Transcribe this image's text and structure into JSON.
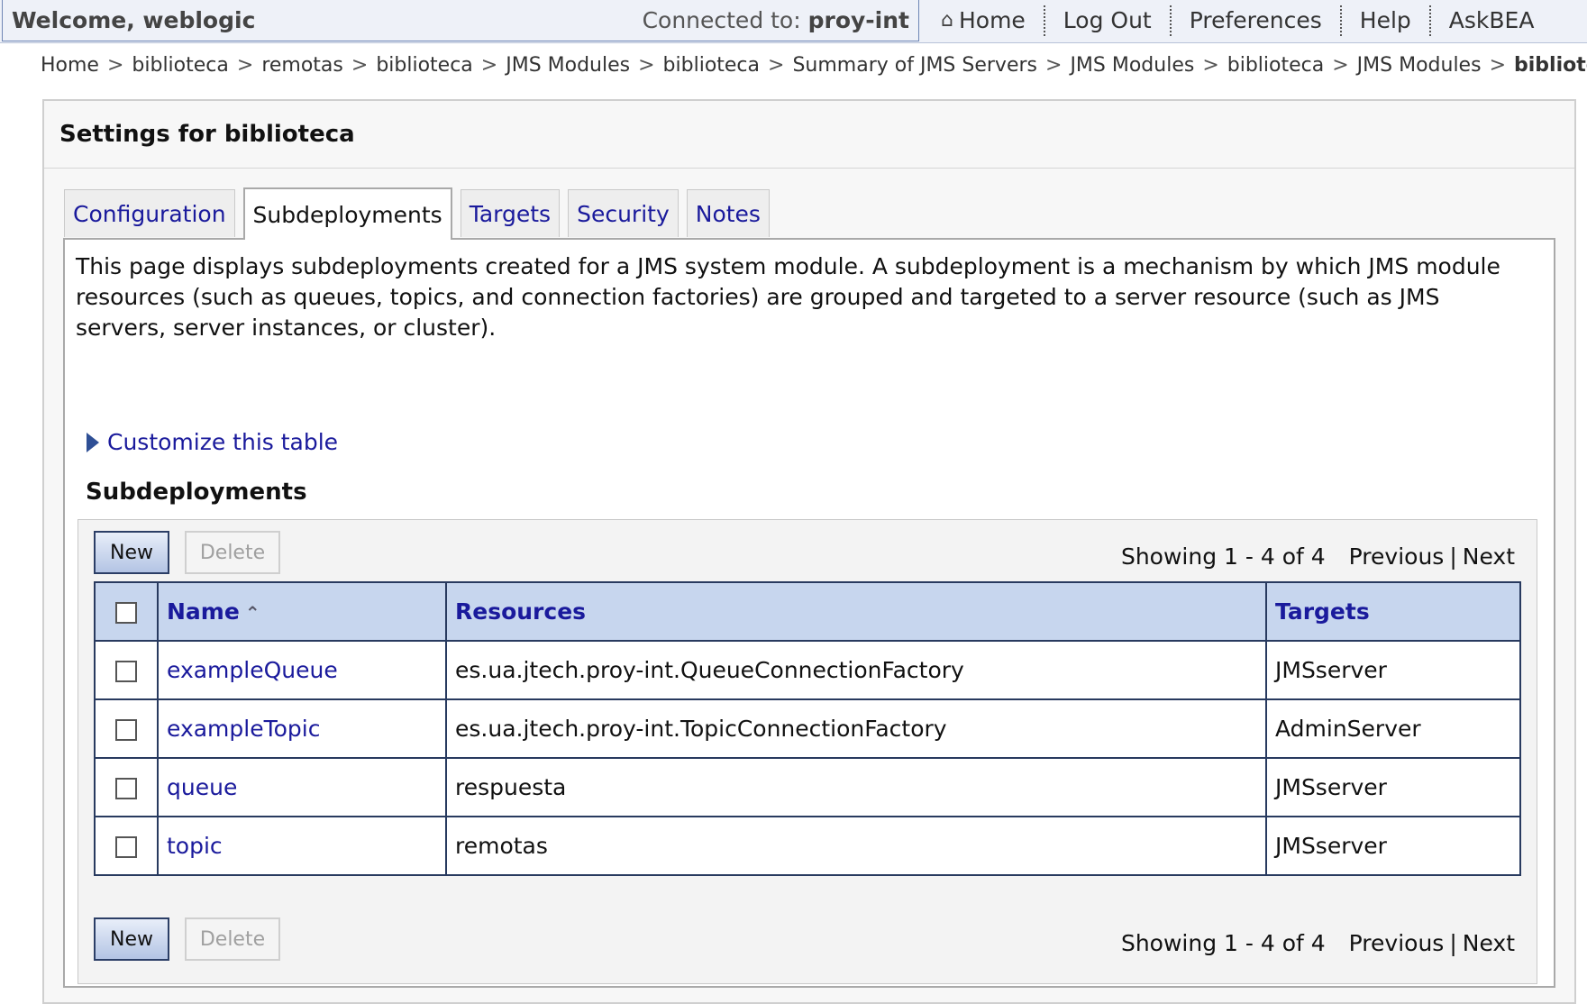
{
  "topbar": {
    "welcome": "Welcome, weblogic",
    "connected_label": "Connected to:",
    "connected_server": "proy-int",
    "nav": [
      {
        "label": "Home",
        "icon": "home-icon"
      },
      {
        "label": "Log Out"
      },
      {
        "label": "Preferences"
      },
      {
        "label": "Help"
      },
      {
        "label": "AskBEA"
      }
    ]
  },
  "breadcrumb": {
    "items": [
      "Home",
      "biblioteca",
      "remotas",
      "biblioteca",
      "JMS Modules",
      "biblioteca",
      "Summary of JMS Servers",
      "JMS Modules",
      "biblioteca",
      "JMS Modules"
    ],
    "separator": ">",
    "current": "biblioteca"
  },
  "settings": {
    "title": "Settings for biblioteca",
    "tabs": [
      {
        "label": "Configuration",
        "active": false
      },
      {
        "label": "Subdeployments",
        "active": true
      },
      {
        "label": "Targets",
        "active": false
      },
      {
        "label": "Security",
        "active": false
      },
      {
        "label": "Notes",
        "active": false
      }
    ],
    "description": "This page displays subdeployments created for a JMS system module. A subdeployment is a mechanism by which JMS module resources (such as queues, topics, and connection factories) are grouped and targeted to a server resource (such as JMS servers, server instances, or cluster).",
    "customize_label": "Customize this table",
    "table_title": "Subdeployments"
  },
  "table": {
    "new_label": "New",
    "delete_label": "Delete",
    "showing": "Showing 1 - 4 of 4",
    "previous": "Previous",
    "pipe": "|",
    "next": "Next",
    "columns": [
      "Name",
      "Resources",
      "Targets"
    ],
    "rows": [
      {
        "name": "exampleQueue",
        "resources": "es.ua.jtech.proy-int.QueueConnectionFactory",
        "targets": "JMSserver"
      },
      {
        "name": "exampleTopic",
        "resources": "es.ua.jtech.proy-int.TopicConnectionFactory",
        "targets": "AdminServer"
      },
      {
        "name": "queue",
        "resources": "respuesta",
        "targets": "JMSserver"
      },
      {
        "name": "topic",
        "resources": "remotas",
        "targets": "JMSserver"
      }
    ]
  },
  "colors": {
    "link": "#1a1a9c",
    "header_bg": "#c7d6ee",
    "table_border": "#283a5f",
    "topbar_bg": "#eef1f8"
  }
}
